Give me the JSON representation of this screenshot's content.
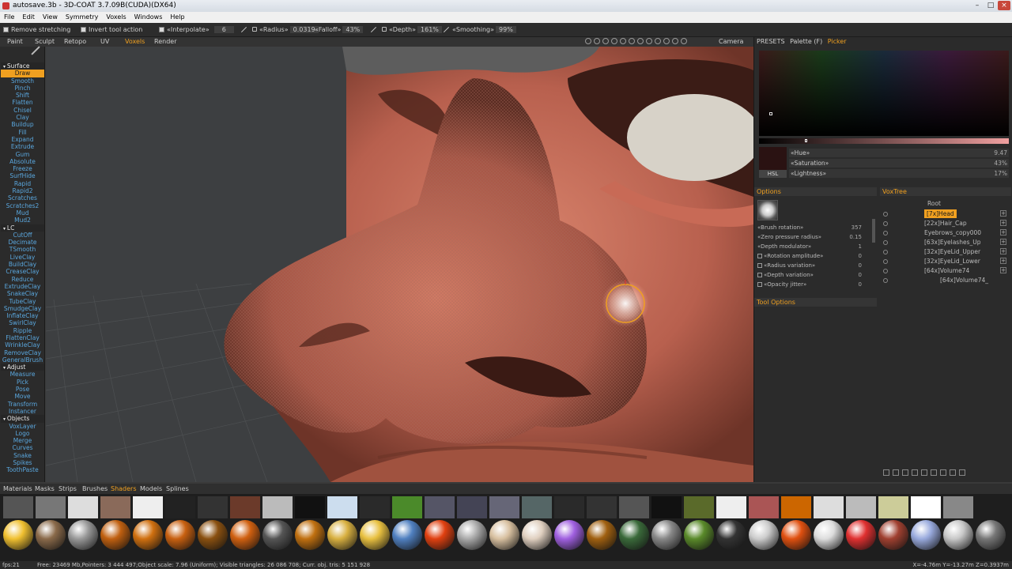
{
  "window": {
    "title": "autosave.3b - 3D-COAT 3.7.09B(CUDA)(DX64)"
  },
  "menu": [
    "File",
    "Edit",
    "View",
    "Symmetry",
    "Voxels",
    "Windows",
    "Help"
  ],
  "toolbar": {
    "remove_stretching": "Remove stretching",
    "invert_tool": "Invert tool action",
    "interpolate_label": "«Interpolate»",
    "interpolate_value": "6",
    "radius_label": "«Radius»",
    "radius_value": "0.0319",
    "falloff_label": "«Falloff»",
    "falloff_value": "43%",
    "depth_label": "«Depth»",
    "depth_value": "161%",
    "smoothing_label": "«Smoothing»",
    "smoothing_value": "99%"
  },
  "rooms": {
    "tabs": [
      "Paint",
      "Sculpt",
      "Retopo",
      "UV",
      "Voxels",
      "Render"
    ],
    "active": "Voxels",
    "camera": "Camera"
  },
  "tools": [
    {
      "label": "Surface",
      "type": "section"
    },
    {
      "label": "Draw",
      "type": "active"
    },
    {
      "label": "Smooth"
    },
    {
      "label": "Pinch"
    },
    {
      "label": "Shift"
    },
    {
      "label": "Flatten"
    },
    {
      "label": "Chisel"
    },
    {
      "label": "Clay"
    },
    {
      "label": "Buildup"
    },
    {
      "label": "Fill"
    },
    {
      "label": "Expand"
    },
    {
      "label": "Extrude"
    },
    {
      "label": "Gum"
    },
    {
      "label": "Absolute"
    },
    {
      "label": "Freeze"
    },
    {
      "label": "SurfHide"
    },
    {
      "label": "Rapid"
    },
    {
      "label": "Rapid2"
    },
    {
      "label": "Scratches"
    },
    {
      "label": "Scratches2"
    },
    {
      "label": "Mud"
    },
    {
      "label": "Mud2"
    },
    {
      "label": "LC",
      "type": "section"
    },
    {
      "label": "CutOff"
    },
    {
      "label": "Decimate"
    },
    {
      "label": "TSmooth"
    },
    {
      "label": "LiveClay"
    },
    {
      "label": "BuildClay"
    },
    {
      "label": "CreaseClay"
    },
    {
      "label": "Reduce"
    },
    {
      "label": "ExtrudeClay"
    },
    {
      "label": "SnakeClay"
    },
    {
      "label": "TubeClay"
    },
    {
      "label": "SmudgeClay"
    },
    {
      "label": "InflateClay"
    },
    {
      "label": "SwirlClay"
    },
    {
      "label": "Ripple"
    },
    {
      "label": "FlattenClay"
    },
    {
      "label": "WrinkleClay"
    },
    {
      "label": "RemoveClay"
    },
    {
      "label": "GeneralBrush"
    },
    {
      "label": "Adjust",
      "type": "section"
    },
    {
      "label": "Measure"
    },
    {
      "label": "Pick"
    },
    {
      "label": "Pose"
    },
    {
      "label": "Move"
    },
    {
      "label": "Transform"
    },
    {
      "label": "Instancer"
    },
    {
      "label": "Objects",
      "type": "section"
    },
    {
      "label": "VoxLayer"
    },
    {
      "label": "Logo"
    },
    {
      "label": "Merge"
    },
    {
      "label": "Curves"
    },
    {
      "label": "Snake"
    },
    {
      "label": "Spikes"
    },
    {
      "label": "ToothPaste"
    }
  ],
  "right_tabs": {
    "presets": "PRESETS",
    "palette": "Palette (F)",
    "picker": "Picker"
  },
  "color": {
    "hue_label": "«Hue»",
    "hue_value": "9.47",
    "saturation_label": "«Saturation»",
    "saturation_value": "43%",
    "lightness_label": "«Lightness»",
    "lightness_value": "17%",
    "hsl": "HSL",
    "swatch": "#2a1212"
  },
  "options": {
    "header": "Options",
    "rows": [
      {
        "label": "«Brush rotation»",
        "value": "357"
      },
      {
        "label": "«Zero pressure radius»",
        "value": "0.15"
      },
      {
        "label": "«Depth modulator»",
        "value": "1"
      },
      {
        "label": "«Rotation amplitude»",
        "value": "0"
      },
      {
        "label": "«Radius variation»",
        "value": "0"
      },
      {
        "label": "«Depth variation»",
        "value": "0"
      },
      {
        "label": "«Opacity jitter»",
        "value": "0"
      }
    ],
    "tool_options": "Tool Options"
  },
  "voxtree": {
    "header": "VoxTree",
    "root": "Root",
    "items": [
      {
        "name": "[7x]Head",
        "active": true
      },
      {
        "name": "[22x]Hair_Cap"
      },
      {
        "name": "Eyebrows_copy000"
      },
      {
        "name": "[63x]Eyelashes_Up"
      },
      {
        "name": "[32x]EyeLid_Upper"
      },
      {
        "name": "[32x]EyeLid_Lower"
      },
      {
        "name": "[64x]Volume74"
      },
      {
        "name": "[64x]Volume74_"
      }
    ]
  },
  "bottom_tabs": {
    "tabs": [
      "Materials",
      "Masks",
      "Strips",
      "Brushes",
      "Shaders",
      "Models",
      "Splines"
    ],
    "active": "Shaders"
  },
  "status": {
    "fps": "fps:21",
    "info": "Free: 23469 Mb,Pointers: 3 444 497;Object scale: 7.96 (Uniform); Visible triangles: 26 086 708; Curr. obj. tris: 5 151 928",
    "coords": "X=-4.76m Y=-13.27m Z=0.3937m"
  },
  "accent": "#f0a020",
  "tool_text_color": "#5aa7de"
}
